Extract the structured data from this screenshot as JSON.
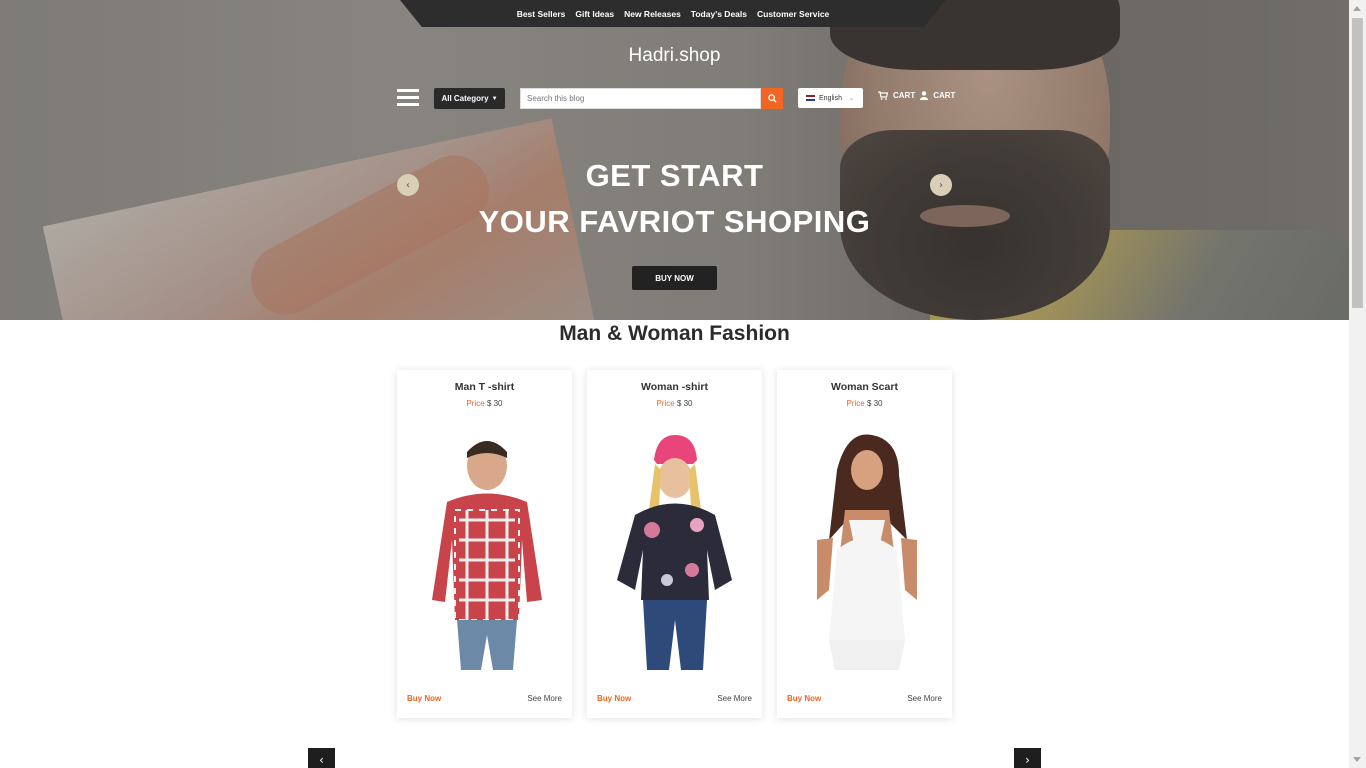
{
  "topnav": {
    "links": [
      "Best Sellers",
      "Gift Ideas",
      "New Releases",
      "Today's Deals",
      "Customer Service"
    ]
  },
  "header": {
    "brand": "Hadri.shop",
    "category_label": "All Category",
    "search_placeholder": "Search this blog",
    "language": "English",
    "cart_label": "CART",
    "account_label": "CART"
  },
  "hero": {
    "title_line1": "GET START",
    "title_line2": "YOUR FAVRIOT SHOPING",
    "cta_label": "BUY NOW"
  },
  "section": {
    "title": "Man & Woman Fashion"
  },
  "products": [
    {
      "name": "Man T -shirt",
      "price_label": "Price",
      "price_value": "$ 30",
      "buy_label": "Buy Now",
      "more_label": "See More"
    },
    {
      "name": "Woman -shirt",
      "price_label": "Price",
      "price_value": "$ 30",
      "buy_label": "Buy Now",
      "more_label": "See More"
    },
    {
      "name": "Woman Scart",
      "price_label": "Price",
      "price_value": "$ 30",
      "buy_label": "Buy Now",
      "more_label": "See More"
    }
  ],
  "icons": {
    "menu": "hamburger-icon",
    "search": "search-icon",
    "cart": "cart-icon",
    "user": "user-icon",
    "prev": "chevron-left-icon",
    "next": "chevron-right-icon"
  },
  "colors": {
    "accent": "#f26522",
    "dark": "#222222"
  }
}
